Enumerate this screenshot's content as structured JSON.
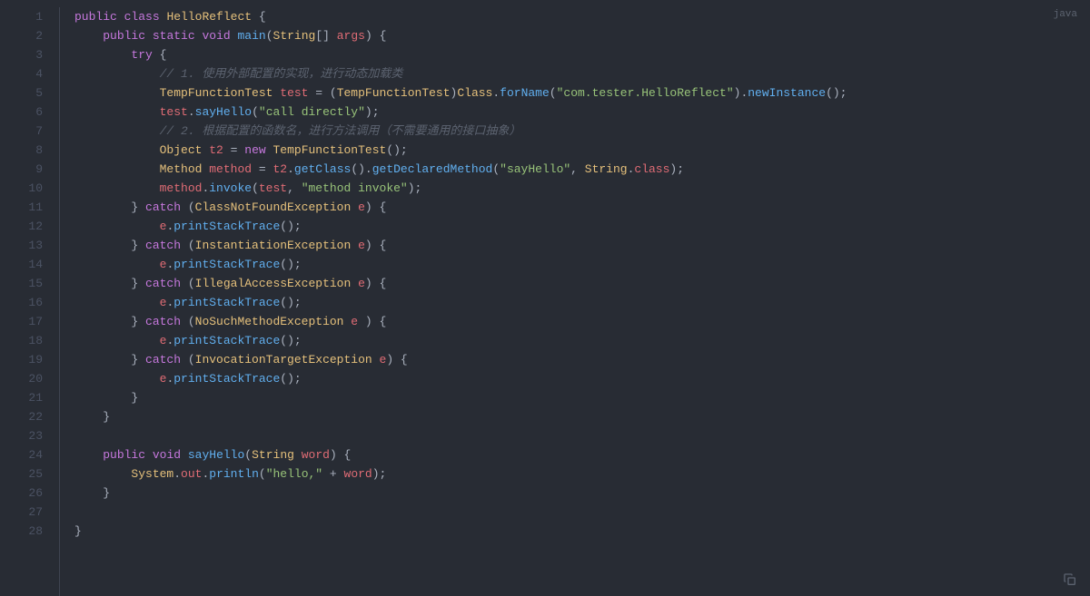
{
  "language_label": "java",
  "line_count": 28,
  "lines": [
    [
      [
        "kw",
        "public"
      ],
      [
        "pun",
        " "
      ],
      [
        "kw",
        "class"
      ],
      [
        "pun",
        " "
      ],
      [
        "type",
        "HelloReflect"
      ],
      [
        "pun",
        " {"
      ]
    ],
    [
      [
        "pun",
        "    "
      ],
      [
        "kw",
        "public"
      ],
      [
        "pun",
        " "
      ],
      [
        "kw",
        "static"
      ],
      [
        "pun",
        " "
      ],
      [
        "kw",
        "void"
      ],
      [
        "pun",
        " "
      ],
      [
        "fn",
        "main"
      ],
      [
        "pun",
        "("
      ],
      [
        "type",
        "String"
      ],
      [
        "pun",
        "[] "
      ],
      [
        "var",
        "args"
      ],
      [
        "pun",
        ") {"
      ]
    ],
    [
      [
        "pun",
        "        "
      ],
      [
        "kw",
        "try"
      ],
      [
        "pun",
        " {"
      ]
    ],
    [
      [
        "pun",
        "            "
      ],
      [
        "com",
        "// 1. 使用外部配置的实现，进行动态加载类"
      ]
    ],
    [
      [
        "pun",
        "            "
      ],
      [
        "type",
        "TempFunctionTest"
      ],
      [
        "pun",
        " "
      ],
      [
        "var",
        "test"
      ],
      [
        "pun",
        " = ("
      ],
      [
        "type",
        "TempFunctionTest"
      ],
      [
        "pun",
        ")"
      ],
      [
        "type",
        "Class"
      ],
      [
        "pun",
        "."
      ],
      [
        "fn",
        "forName"
      ],
      [
        "pun",
        "("
      ],
      [
        "str",
        "\"com.tester.HelloReflect\""
      ],
      [
        "pun",
        ")."
      ],
      [
        "fn",
        "newInstance"
      ],
      [
        "pun",
        "();"
      ]
    ],
    [
      [
        "pun",
        "            "
      ],
      [
        "var",
        "test"
      ],
      [
        "pun",
        "."
      ],
      [
        "fn",
        "sayHello"
      ],
      [
        "pun",
        "("
      ],
      [
        "str",
        "\"call directly\""
      ],
      [
        "pun",
        ");"
      ]
    ],
    [
      [
        "pun",
        "            "
      ],
      [
        "com",
        "// 2. 根据配置的函数名，进行方法调用（不需要通用的接口抽象）"
      ]
    ],
    [
      [
        "pun",
        "            "
      ],
      [
        "type",
        "Object"
      ],
      [
        "pun",
        " "
      ],
      [
        "var",
        "t2"
      ],
      [
        "pun",
        " = "
      ],
      [
        "kw",
        "new"
      ],
      [
        "pun",
        " "
      ],
      [
        "type",
        "TempFunctionTest"
      ],
      [
        "pun",
        "();"
      ]
    ],
    [
      [
        "pun",
        "            "
      ],
      [
        "type",
        "Method"
      ],
      [
        "pun",
        " "
      ],
      [
        "var",
        "method"
      ],
      [
        "pun",
        " = "
      ],
      [
        "var",
        "t2"
      ],
      [
        "pun",
        "."
      ],
      [
        "fn",
        "getClass"
      ],
      [
        "pun",
        "()."
      ],
      [
        "fn",
        "getDeclaredMethod"
      ],
      [
        "pun",
        "("
      ],
      [
        "str",
        "\"sayHello\""
      ],
      [
        "pun",
        ", "
      ],
      [
        "type",
        "String"
      ],
      [
        "pun",
        "."
      ],
      [
        "var",
        "class"
      ],
      [
        "pun",
        ");"
      ]
    ],
    [
      [
        "pun",
        "            "
      ],
      [
        "var",
        "method"
      ],
      [
        "pun",
        "."
      ],
      [
        "fn",
        "invoke"
      ],
      [
        "pun",
        "("
      ],
      [
        "var",
        "test"
      ],
      [
        "pun",
        ", "
      ],
      [
        "str",
        "\"method invoke\""
      ],
      [
        "pun",
        ");"
      ]
    ],
    [
      [
        "pun",
        "        } "
      ],
      [
        "kw",
        "catch"
      ],
      [
        "pun",
        " ("
      ],
      [
        "type",
        "ClassNotFoundException"
      ],
      [
        "pun",
        " "
      ],
      [
        "var",
        "e"
      ],
      [
        "pun",
        ") {"
      ]
    ],
    [
      [
        "pun",
        "            "
      ],
      [
        "var",
        "e"
      ],
      [
        "pun",
        "."
      ],
      [
        "fn",
        "printStackTrace"
      ],
      [
        "pun",
        "();"
      ]
    ],
    [
      [
        "pun",
        "        } "
      ],
      [
        "kw",
        "catch"
      ],
      [
        "pun",
        " ("
      ],
      [
        "type",
        "InstantiationException"
      ],
      [
        "pun",
        " "
      ],
      [
        "var",
        "e"
      ],
      [
        "pun",
        ") {"
      ]
    ],
    [
      [
        "pun",
        "            "
      ],
      [
        "var",
        "e"
      ],
      [
        "pun",
        "."
      ],
      [
        "fn",
        "printStackTrace"
      ],
      [
        "pun",
        "();"
      ]
    ],
    [
      [
        "pun",
        "        } "
      ],
      [
        "kw",
        "catch"
      ],
      [
        "pun",
        " ("
      ],
      [
        "type",
        "IllegalAccessException"
      ],
      [
        "pun",
        " "
      ],
      [
        "var",
        "e"
      ],
      [
        "pun",
        ") {"
      ]
    ],
    [
      [
        "pun",
        "            "
      ],
      [
        "var",
        "e"
      ],
      [
        "pun",
        "."
      ],
      [
        "fn",
        "printStackTrace"
      ],
      [
        "pun",
        "();"
      ]
    ],
    [
      [
        "pun",
        "        } "
      ],
      [
        "kw",
        "catch"
      ],
      [
        "pun",
        " ("
      ],
      [
        "type",
        "NoSuchMethodException"
      ],
      [
        "pun",
        " "
      ],
      [
        "var",
        "e"
      ],
      [
        "pun",
        " ) {"
      ]
    ],
    [
      [
        "pun",
        "            "
      ],
      [
        "var",
        "e"
      ],
      [
        "pun",
        "."
      ],
      [
        "fn",
        "printStackTrace"
      ],
      [
        "pun",
        "();"
      ]
    ],
    [
      [
        "pun",
        "        } "
      ],
      [
        "kw",
        "catch"
      ],
      [
        "pun",
        " ("
      ],
      [
        "type",
        "InvocationTargetException"
      ],
      [
        "pun",
        " "
      ],
      [
        "var",
        "e"
      ],
      [
        "pun",
        ") {"
      ]
    ],
    [
      [
        "pun",
        "            "
      ],
      [
        "var",
        "e"
      ],
      [
        "pun",
        "."
      ],
      [
        "fn",
        "printStackTrace"
      ],
      [
        "pun",
        "();"
      ]
    ],
    [
      [
        "pun",
        "        }"
      ]
    ],
    [
      [
        "pun",
        "    }"
      ]
    ],
    [
      [
        "pun",
        ""
      ]
    ],
    [
      [
        "pun",
        "    "
      ],
      [
        "kw",
        "public"
      ],
      [
        "pun",
        " "
      ],
      [
        "kw",
        "void"
      ],
      [
        "pun",
        " "
      ],
      [
        "fn",
        "sayHello"
      ],
      [
        "pun",
        "("
      ],
      [
        "type",
        "String"
      ],
      [
        "pun",
        " "
      ],
      [
        "var",
        "word"
      ],
      [
        "pun",
        ") {"
      ]
    ],
    [
      [
        "pun",
        "        "
      ],
      [
        "type",
        "System"
      ],
      [
        "pun",
        "."
      ],
      [
        "var",
        "out"
      ],
      [
        "pun",
        "."
      ],
      [
        "fn",
        "println"
      ],
      [
        "pun",
        "("
      ],
      [
        "str",
        "\"hello,\""
      ],
      [
        "pun",
        " + "
      ],
      [
        "var",
        "word"
      ],
      [
        "pun",
        ");"
      ]
    ],
    [
      [
        "pun",
        "    }"
      ]
    ],
    [
      [
        "pun",
        ""
      ]
    ],
    [
      [
        "pun",
        "}"
      ]
    ]
  ]
}
